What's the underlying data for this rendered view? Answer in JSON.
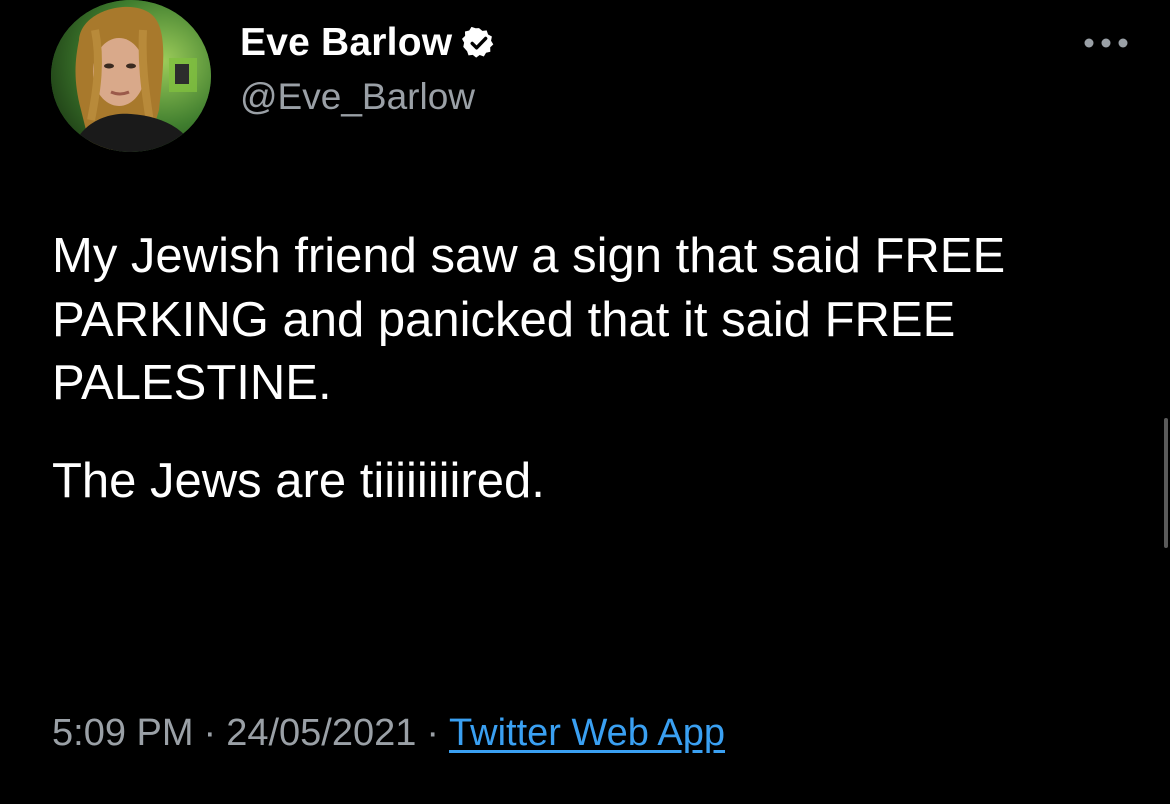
{
  "colors": {
    "background": "#000000",
    "text": "#ffffff",
    "secondary_text": "#9aa0a6",
    "link": "#3aa0f2",
    "verified_badge": "#ffffff"
  },
  "author": {
    "display_name": "Eve Barlow",
    "handle": "@Eve_Barlow",
    "verified": true,
    "avatar_icon": "profile-photo",
    "verified_icon": "verified-badge-icon"
  },
  "menu": {
    "icon": "more-options-icon"
  },
  "tweet": {
    "paragraphs": [
      "My Jewish friend saw a sign that said FREE PARKING and panicked that it said FREE PALESTINE.",
      "The Jews are tiiiiiiiired."
    ]
  },
  "meta": {
    "time": "5:09 PM",
    "separator": "·",
    "date": "24/05/2021",
    "source": "Twitter Web App"
  }
}
